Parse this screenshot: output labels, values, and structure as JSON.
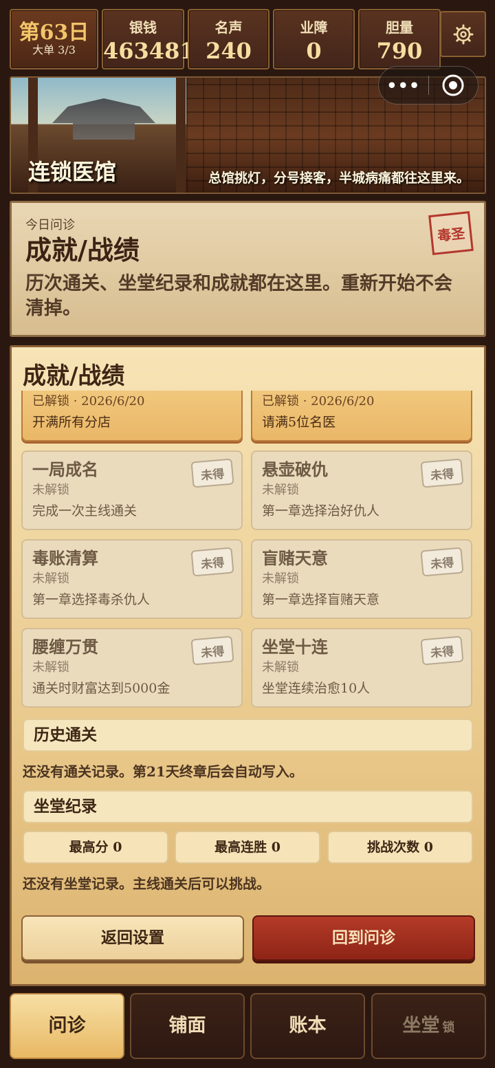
{
  "topbar": {
    "day": "第63日",
    "order": "大单 3/3",
    "stats": [
      {
        "label": "银钱",
        "value": "463481"
      },
      {
        "label": "名声",
        "value": "240"
      },
      {
        "label": "业障",
        "value": "0"
      },
      {
        "label": "胆量",
        "value": "790"
      }
    ],
    "settings_icon": "gear-icon"
  },
  "banner": {
    "title": "连锁医馆",
    "subtitle": "总馆挑灯，分号接客，半城病痛都往这里来。",
    "capsule": {
      "more": "•••",
      "target_icon": "target-icon"
    }
  },
  "intro": {
    "eyebrow": "今日问诊",
    "title": "成就/战绩",
    "description": "历次通关、坐堂纪录和成就都在这里。重新开始不会清掉。",
    "seal": "毒圣"
  },
  "panel": {
    "title": "成就/战绩",
    "unlocked": [
      {
        "status": "已解锁 · 2026/6/20",
        "desc": "开满所有分店"
      },
      {
        "status": "已解锁 · 2026/6/20",
        "desc": "请满5位名医"
      }
    ],
    "locked": [
      {
        "name": "一局成名",
        "status": "未解锁",
        "desc": "完成一次主线通关",
        "badge": "未得"
      },
      {
        "name": "悬壶破仇",
        "status": "未解锁",
        "desc": "第一章选择治好仇人",
        "badge": "未得"
      },
      {
        "name": "毒账清算",
        "status": "未解锁",
        "desc": "第一章选择毒杀仇人",
        "badge": "未得"
      },
      {
        "name": "盲赌天意",
        "status": "未解锁",
        "desc": "第一章选择盲赌天意",
        "badge": "未得"
      },
      {
        "name": "腰缠万贯",
        "status": "未解锁",
        "desc": "通关时财富达到5000金",
        "badge": "未得"
      },
      {
        "name": "坐堂十连",
        "status": "未解锁",
        "desc": "坐堂连续治愈10人",
        "badge": "未得"
      }
    ],
    "history": {
      "title": "历史通关",
      "empty": "还没有通关记录。第21天终章后会自动写入。"
    },
    "records": {
      "title": "坐堂纪录",
      "stats": [
        "最高分 0",
        "最高连胜 0",
        "挑战次数 0"
      ],
      "empty": "还没有坐堂记录。主线通关后可以挑战。"
    },
    "back_label": "返回设置",
    "primary_label": "回到问诊"
  },
  "tabs": [
    {
      "label": "问诊",
      "active": true
    },
    {
      "label": "铺面"
    },
    {
      "label": "账本"
    },
    {
      "label": "坐堂",
      "lock": "锁"
    }
  ]
}
